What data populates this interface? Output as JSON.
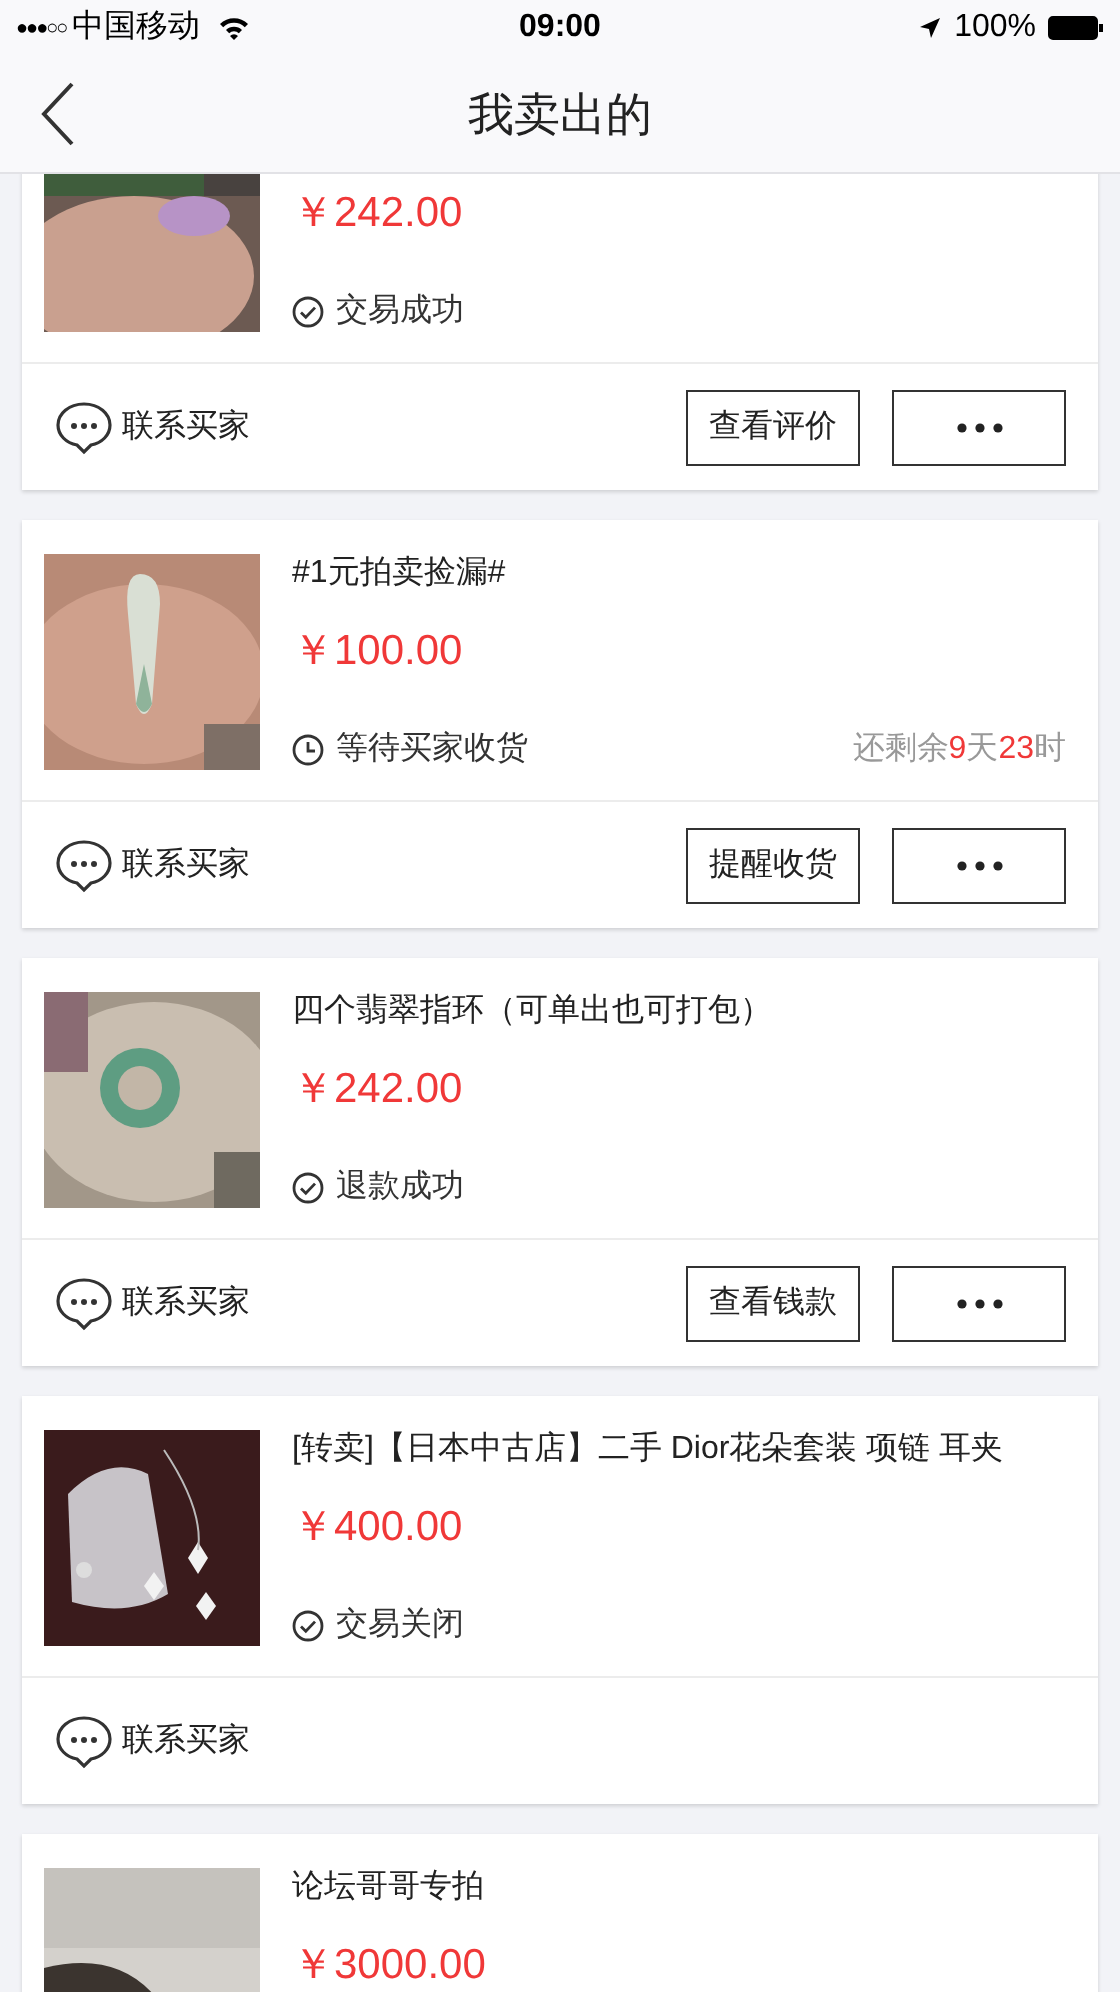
{
  "status_bar": {
    "signal": "●●●○○",
    "carrier": "中国移动",
    "time": "09:00",
    "battery": "100%"
  },
  "nav": {
    "title": "我卖出的"
  },
  "orders": [
    {
      "price": "￥242.00",
      "status": {
        "kind": "done",
        "text": "交易成功"
      },
      "contact": "联系买家",
      "actions": [
        {
          "kind": "text",
          "label": "查看评价"
        },
        {
          "kind": "more"
        }
      ]
    },
    {
      "title": "#1元拍卖捡漏#",
      "price": "￥100.00",
      "status": {
        "kind": "waiting",
        "text": "等待买家收货"
      },
      "remaining": [
        {
          "text": "还剩余",
          "highlight": false
        },
        {
          "text": "9",
          "highlight": true
        },
        {
          "text": "天",
          "highlight": false
        },
        {
          "text": "23",
          "highlight": true
        },
        {
          "text": "时",
          "highlight": false
        }
      ],
      "contact": "联系买家",
      "actions": [
        {
          "kind": "text",
          "label": "提醒收货"
        },
        {
          "kind": "more"
        }
      ]
    },
    {
      "title": "四个翡翠指环（可单出也可打包）",
      "price": "￥242.00",
      "status": {
        "kind": "done",
        "text": "退款成功"
      },
      "contact": "联系买家",
      "actions": [
        {
          "kind": "text",
          "label": "查看钱款"
        },
        {
          "kind": "more"
        }
      ]
    },
    {
      "title": "[转卖]【日本中古店】二手 Dior花朵套装 项链 耳夹",
      "price": "￥400.00",
      "status": {
        "kind": "done",
        "text": "交易关闭"
      },
      "contact": "联系买家"
    },
    {
      "title": "论坛哥哥专拍",
      "price": "￥3000.00"
    }
  ]
}
